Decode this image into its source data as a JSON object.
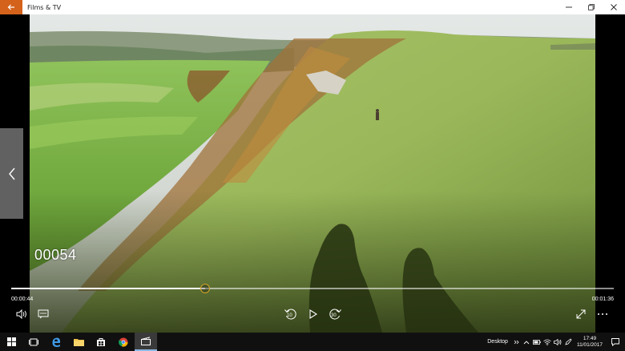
{
  "window": {
    "title": "Films & TV",
    "accent_color": "#d4621a",
    "back_icon": "back-arrow-icon",
    "controls": [
      "minimize-icon",
      "maximize-icon",
      "close-icon"
    ]
  },
  "video": {
    "overlay_text": "00054",
    "scene": "green coastal hillside with walker and shadows"
  },
  "player": {
    "elapsed": "00:00:44",
    "total": "00:01:36",
    "progress_fraction": 0.322,
    "skip_back_label": "10",
    "skip_forward_label": "30",
    "thumb_color": "#d4a52a",
    "icons": [
      "volume-icon",
      "subtitles-icon",
      "skip-back-icon",
      "play-icon",
      "skip-forward-icon",
      "fullscreen-icon",
      "more-icon"
    ]
  },
  "taskbar": {
    "apps": [
      "windows-start-icon",
      "task-view-icon",
      "edge-icon",
      "file-explorer-icon",
      "store-icon",
      "chrome-icon",
      "films-tv-icon"
    ],
    "active_app": "films-tv-icon",
    "desktop_label": "Desktop",
    "time": "17:49",
    "date": "11/01/2017"
  }
}
